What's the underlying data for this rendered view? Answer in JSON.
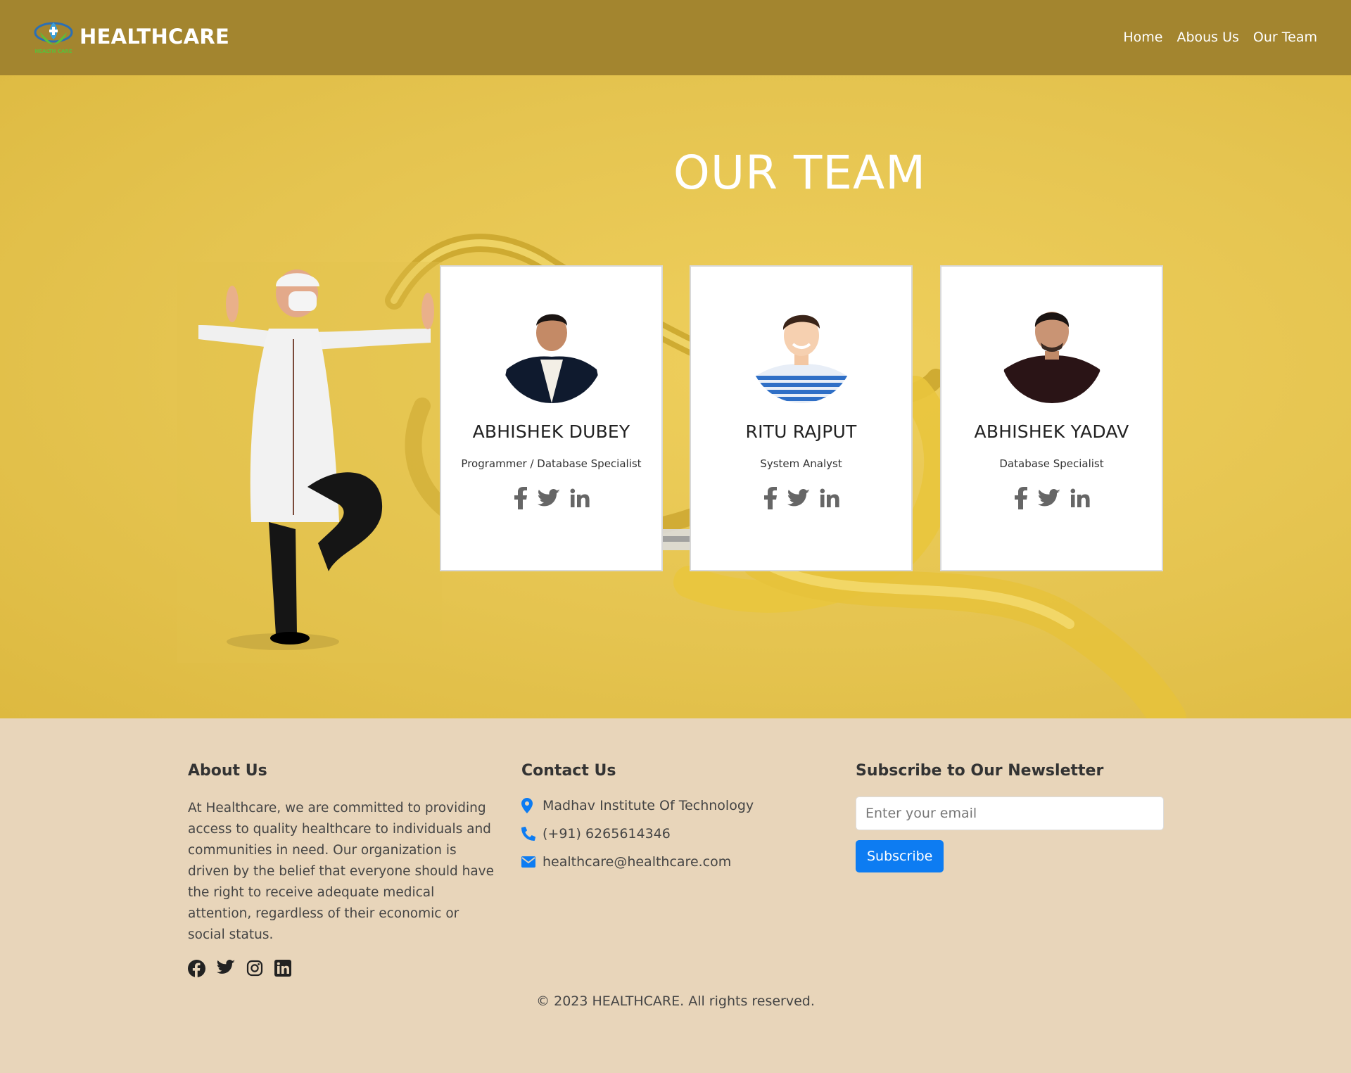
{
  "brand": {
    "name": "HEALTHCARE",
    "logo_icon": "healthcare-logo-icon"
  },
  "nav": {
    "items": [
      "Home",
      "Abous Us",
      "Our Team"
    ]
  },
  "hero": {
    "title": "OUR TEAM"
  },
  "team": [
    {
      "name": "ABHISHEK DUBEY",
      "role": "Programmer / Database Specialist"
    },
    {
      "name": "RITU RAJPUT",
      "role": "System Analyst"
    },
    {
      "name": "ABHISHEK YADAV",
      "role": "Database Specialist"
    }
  ],
  "card_social_icons": [
    "facebook-icon",
    "twitter-icon",
    "linkedin-icon"
  ],
  "footer": {
    "about": {
      "heading": "About Us",
      "text": "At Healthcare, we are committed to providing access to quality healthcare to individuals and communities in need. Our organization is driven by the belief that everyone should have the right to receive adequate medical attention, regardless of their economic or social status.",
      "social_icons": [
        "facebook-icon",
        "twitter-icon",
        "instagram-icon",
        "linkedin-icon"
      ]
    },
    "contact": {
      "heading": "Contact Us",
      "address": "Madhav Institute Of Technology",
      "phone": "(+91) 6265614346",
      "email": "healthcare@healthcare.com"
    },
    "newsletter": {
      "heading": "Subscribe to Our Newsletter",
      "placeholder": "Enter your email",
      "value": "",
      "button": "Subscribe"
    },
    "copyright": "© 2023 HEALTHCARE. All rights reserved."
  },
  "colors": {
    "navbar": "#a3852f",
    "hero_yellow": "#e5c450",
    "footer_bg": "#e8d5ba",
    "accent_blue": "#0d7cf2",
    "icon_gray": "#666666"
  }
}
